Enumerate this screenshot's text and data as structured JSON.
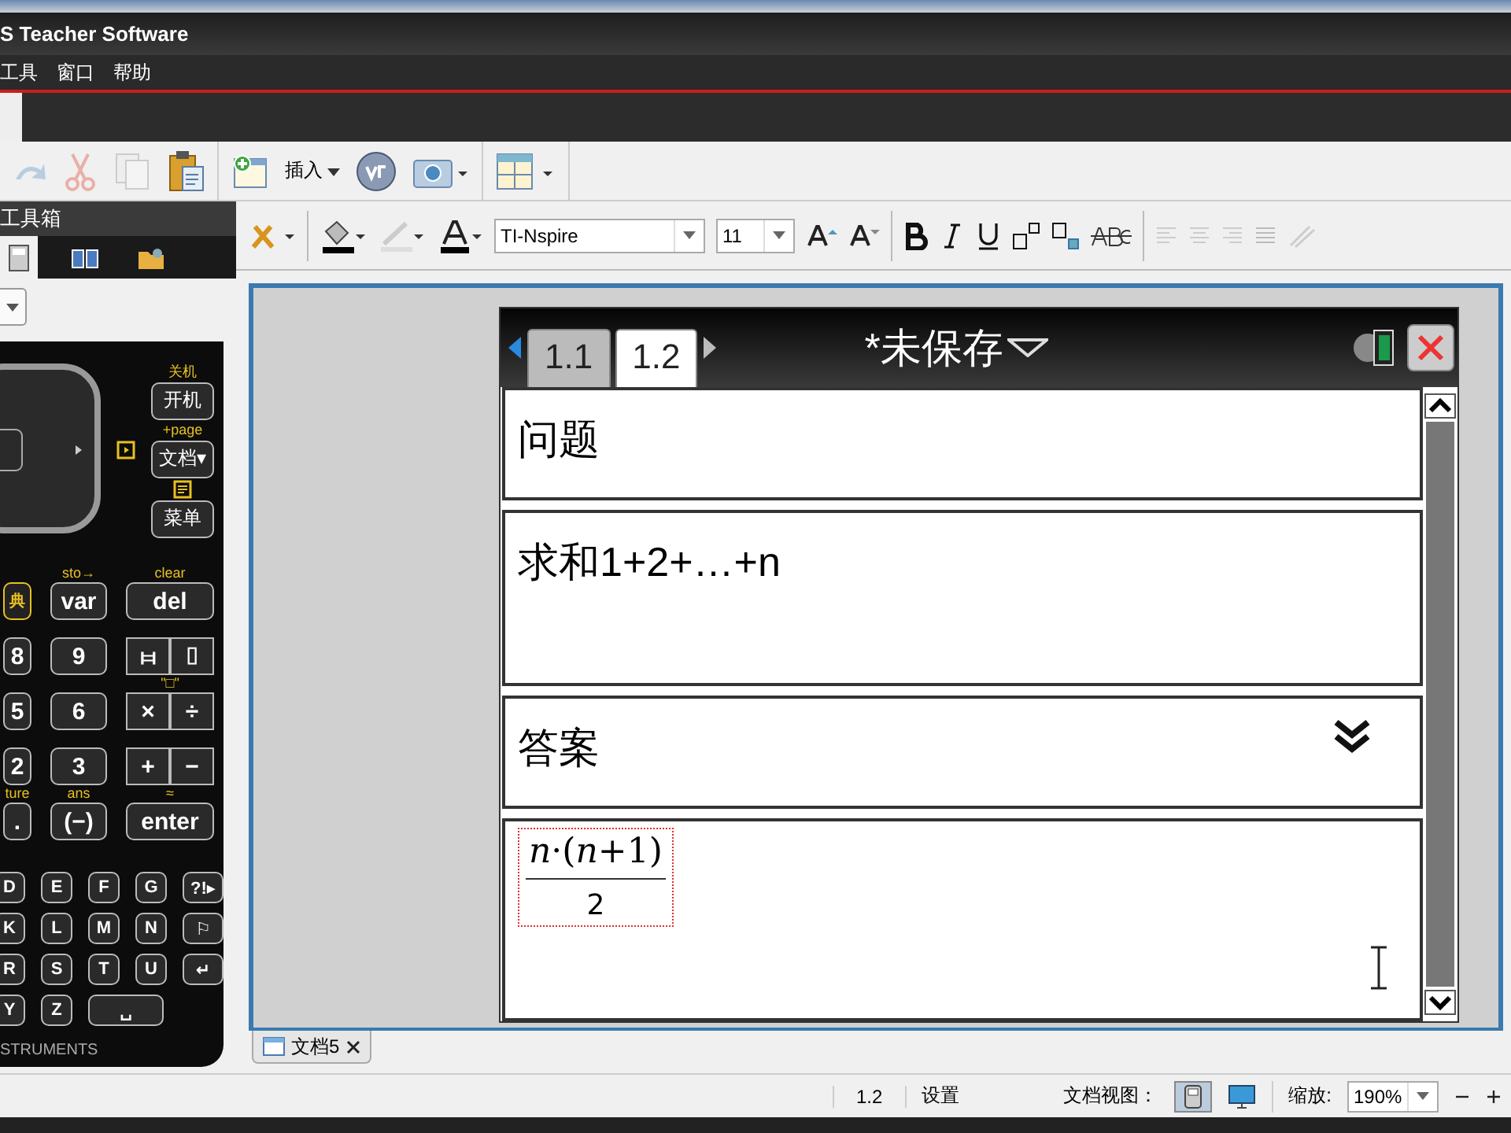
{
  "window": {
    "title": "S Teacher Software"
  },
  "menu": [
    "工具",
    "窗口",
    "帮助"
  ],
  "toolbar": {
    "insert_label": "插入"
  },
  "toolbox": {
    "title": "工具箱",
    "tabs": [
      {
        "kind": "calculator",
        "selected": true
      },
      {
        "kind": "book",
        "selected": false
      },
      {
        "kind": "folder",
        "selected": false
      }
    ]
  },
  "calculator": {
    "side_keys": [
      {
        "caption": "关机",
        "label": "开机"
      },
      {
        "caption": "+page",
        "label": "文档▾"
      },
      {
        "label": "菜单"
      }
    ],
    "number_rows": [
      [
        {
          "kind": "icon",
          "label": "典"
        },
        {
          "kind": "key",
          "caption": "sto→",
          "label": "var"
        },
        {
          "kind": "key",
          "caption": "clear",
          "label": "del"
        }
      ],
      [
        {
          "kind": "key",
          "label": "8"
        },
        {
          "kind": "key",
          "label": "9"
        },
        {
          "kind": "split",
          "left": "⧦",
          "right": "⌷"
        }
      ],
      [
        {
          "kind": "key",
          "label": "5"
        },
        {
          "kind": "key",
          "label": "6"
        },
        {
          "kind": "split",
          "caption": "\"□\"",
          "left": "×",
          "right": "÷"
        }
      ],
      [
        {
          "kind": "key",
          "label": "2"
        },
        {
          "kind": "key",
          "label": "3"
        },
        {
          "kind": "split",
          "left": "+",
          "right": "−"
        }
      ],
      [
        {
          "kind": "key",
          "caption": "ture",
          "label": "."
        },
        {
          "kind": "key",
          "caption": "ans",
          "label": "(−)"
        },
        {
          "kind": "key",
          "caption": "≈",
          "label": "enter"
        }
      ]
    ],
    "letter_rows": [
      [
        "D",
        "E",
        "F",
        "G",
        "?!▸"
      ],
      [
        "K",
        "L",
        "M",
        "N",
        "⚐"
      ],
      [
        "R",
        "S",
        "T",
        "U",
        "↵"
      ],
      [
        "Y",
        "Z",
        "␣"
      ]
    ],
    "brand": "STRUMENTS"
  },
  "format_bar": {
    "font": "TI-Nspire",
    "size": "11"
  },
  "handheld": {
    "tabs": [
      {
        "label": "1.1",
        "selected": false
      },
      {
        "label": "1.2",
        "selected": true
      }
    ],
    "title": "*未保存",
    "blocks": [
      {
        "kind": "text",
        "text": "问题"
      },
      {
        "kind": "text",
        "text": "求和1+2+…+n",
        "tall": true
      },
      {
        "kind": "text",
        "text": "答案",
        "collapsible": true
      },
      {
        "kind": "fraction",
        "numerator": "*n*·(*n*+1)",
        "denominator": "2"
      }
    ]
  },
  "doc_tabs": [
    {
      "label": "文档5",
      "selected": true
    }
  ],
  "status_bar": {
    "page": "1.2",
    "settings": "设置",
    "view_label": "文档视图：",
    "zoom_label": "缩放:",
    "zoom": "190%"
  }
}
